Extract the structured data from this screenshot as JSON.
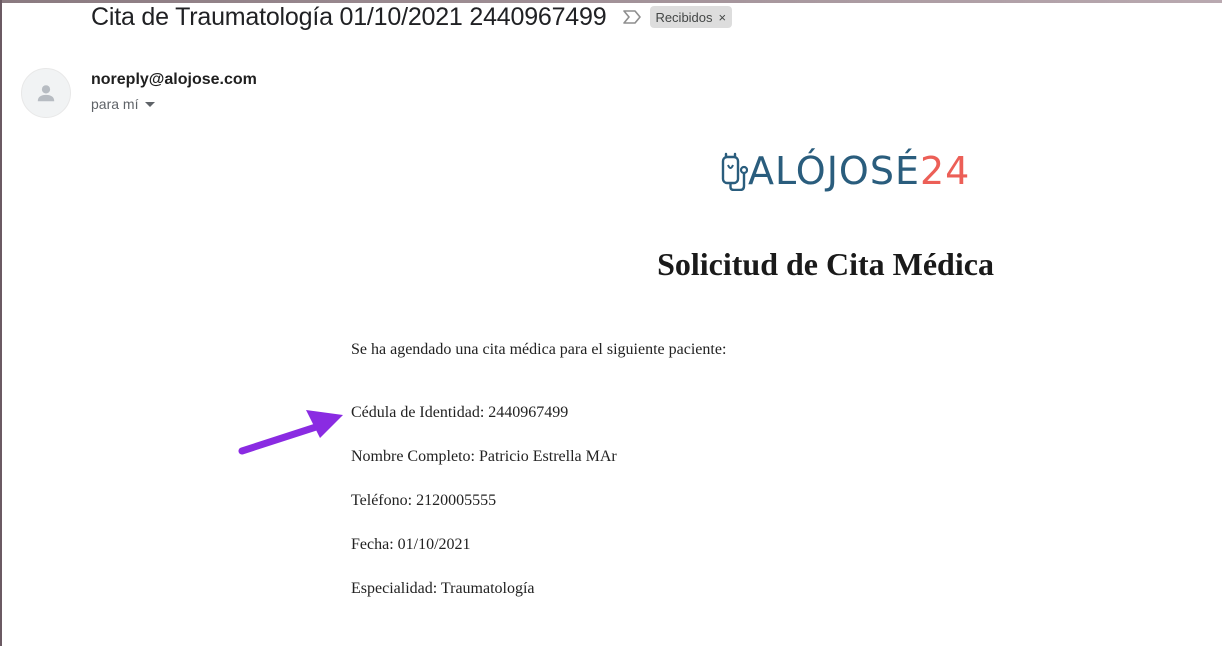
{
  "email": {
    "subject": "Cita de Traumatología 01/10/2021 2440967499",
    "label": "Recibidos",
    "label_close": "×",
    "sender": "noreply@alojose.com",
    "recipient": "para mí"
  },
  "logo": {
    "main": "ALÓJOSÉ",
    "number": "24",
    "main_color": "#2a5d7d",
    "number_color": "#ec5f57"
  },
  "content": {
    "title": "Solicitud de Cita Médica",
    "intro": "Se ha agendado una cita médica para el siguiente paciente:",
    "fields": [
      "Cédula de Identidad: 2440967499",
      "Nombre Completo: Patricio Estrella MAr",
      "Teléfono: 2120005555",
      "Fecha: 01/10/2021",
      "Especialidad: Traumatología"
    ]
  },
  "icons": {
    "important": "important-marker-icon",
    "avatar": "person-icon",
    "dropdown": "chevron-down-icon",
    "annotation": "arrow-annotation-icon"
  },
  "colors": {
    "annotation_arrow": "#8a2be2",
    "chip_background": "#dddddd"
  }
}
